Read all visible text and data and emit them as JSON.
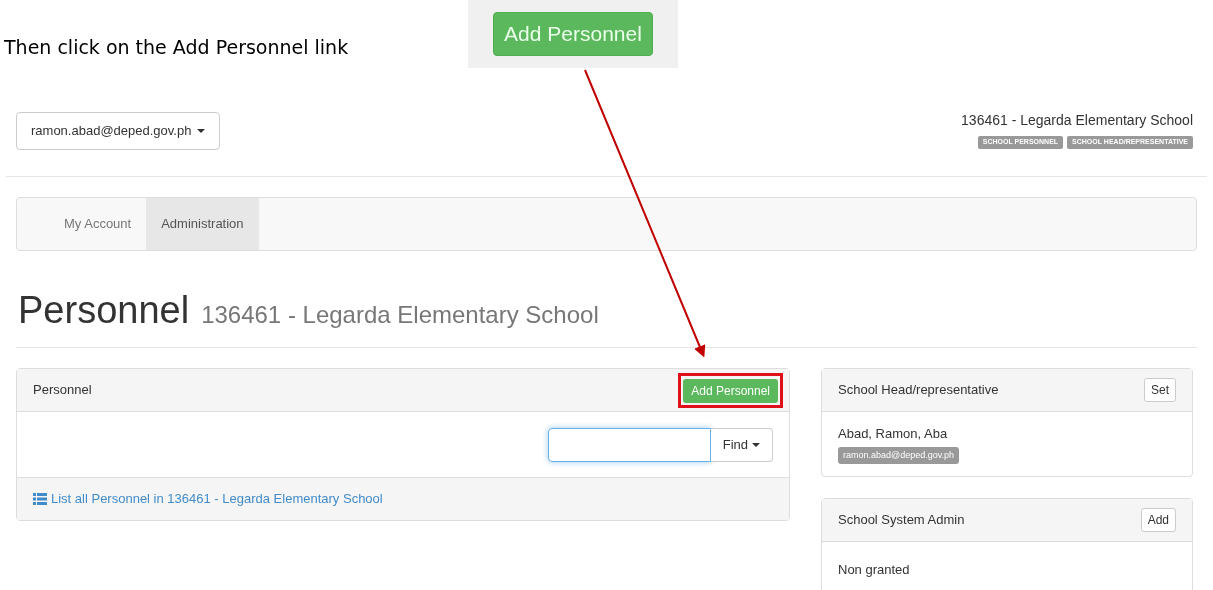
{
  "instruction": "Then click on the Add Personnel link",
  "callout_button": "Add Personnel",
  "account_menu": "ramon.abad@deped.gov.ph",
  "school": "136461 - Legarda Elementary School",
  "roles": [
    "SCHOOL PERSONNEL",
    "SCHOOL HEAD/REPRESENTATIVE"
  ],
  "nav_tabs": [
    {
      "label": "My Account",
      "selected": false
    },
    {
      "label": "Administration",
      "selected": true
    }
  ],
  "page_title": "Personnel",
  "page_subtitle": "136461 - Legarda Elementary School",
  "personnel_panel": {
    "title": "Personnel",
    "add_button": "Add Personnel",
    "highlighted": true,
    "find_button": "Find",
    "list_link": "List all Personnel in 136461 - Legarda Elementary School"
  },
  "side_panels": [
    {
      "kind": "person",
      "title": "School Head/representative",
      "button": "Set",
      "name": "Abad, Ramon, Aba",
      "email": "ramon.abad@deped.gov.ph"
    },
    {
      "kind": "text",
      "title": "School System Admin",
      "button": "Add",
      "text": "Non granted"
    }
  ]
}
